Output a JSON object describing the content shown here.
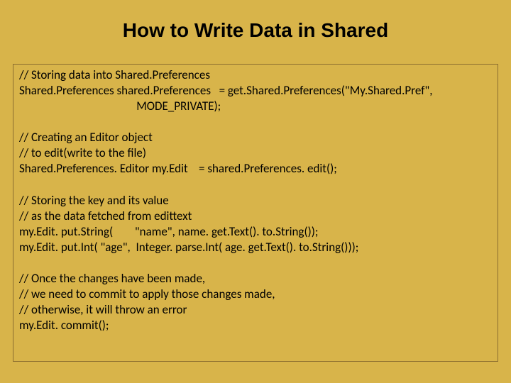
{
  "title": "How to Write Data in Shared",
  "code": {
    "l1": "// Storing data into Shared.Preferences",
    "l2": "Shared.Preferences shared.Preferences   = get.Shared.Preferences(\"My.Shared.Pref\",",
    "l3": "                                           MODE_PRIVATE);",
    "l4": "// Creating an Editor object",
    "l5": "// to edit(write to the file)",
    "l6": "Shared.Preferences. Editor my.Edit    = shared.Preferences. edit();",
    "l7": "// Storing the key and its value",
    "l8": "// as the data fetched from edittext",
    "l9": "my.Edit. put.String(        \"name\", name. get.Text(). to.String());",
    "l10": "my.Edit. put.Int( \"age\",  Integer. parse.Int( age. get.Text(). to.String()));",
    "l11": "// Once the changes have been made,",
    "l12": "// we need to commit to apply those changes made,",
    "l13": "// otherwise, it will throw an error",
    "l14": "my.Edit. commit();"
  }
}
